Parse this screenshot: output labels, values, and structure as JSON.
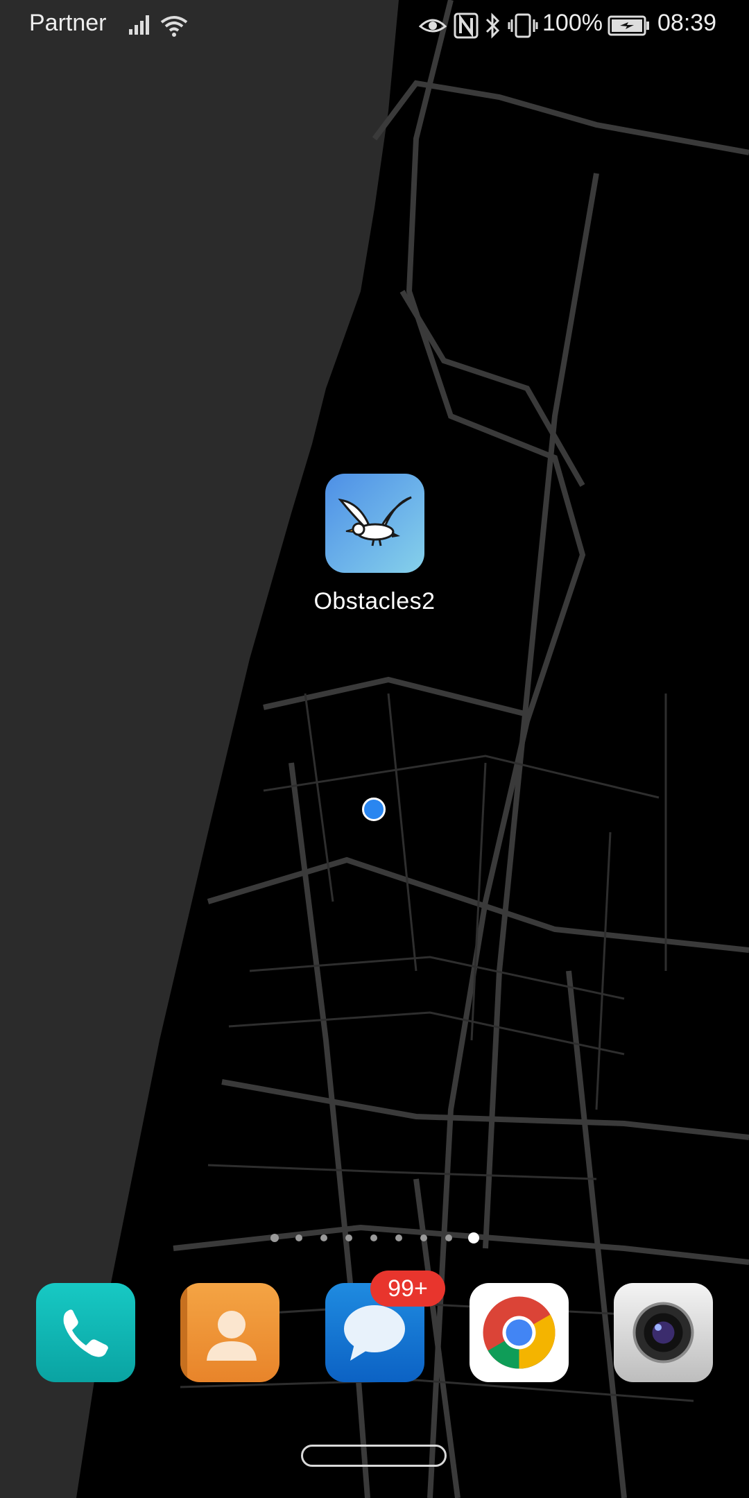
{
  "status_bar": {
    "carrier": "Partner",
    "battery_percent": "100%",
    "time": "08:39",
    "icons": [
      "signal-icon",
      "wifi-icon",
      "eye-icon",
      "nfc-icon",
      "bluetooth-icon",
      "vibrate-icon",
      "battery-charging-icon"
    ]
  },
  "home": {
    "apps": [
      {
        "label": "Obstacles2",
        "icon": "seagull-icon"
      }
    ],
    "page_indicator": {
      "count": 9,
      "active_index": 8
    }
  },
  "dock": {
    "apps": [
      {
        "name": "phone",
        "icon": "phone-icon"
      },
      {
        "name": "contacts",
        "icon": "contacts-icon"
      },
      {
        "name": "messages",
        "icon": "messages-icon",
        "badge": "99+"
      },
      {
        "name": "chrome",
        "icon": "chrome-icon"
      },
      {
        "name": "camera",
        "icon": "camera-icon"
      }
    ]
  },
  "colors": {
    "sea": "#2b2b2b",
    "land": "#000000",
    "roads": "#3a3a3a",
    "location": "#2a86f0",
    "badge": "#e8352d"
  }
}
